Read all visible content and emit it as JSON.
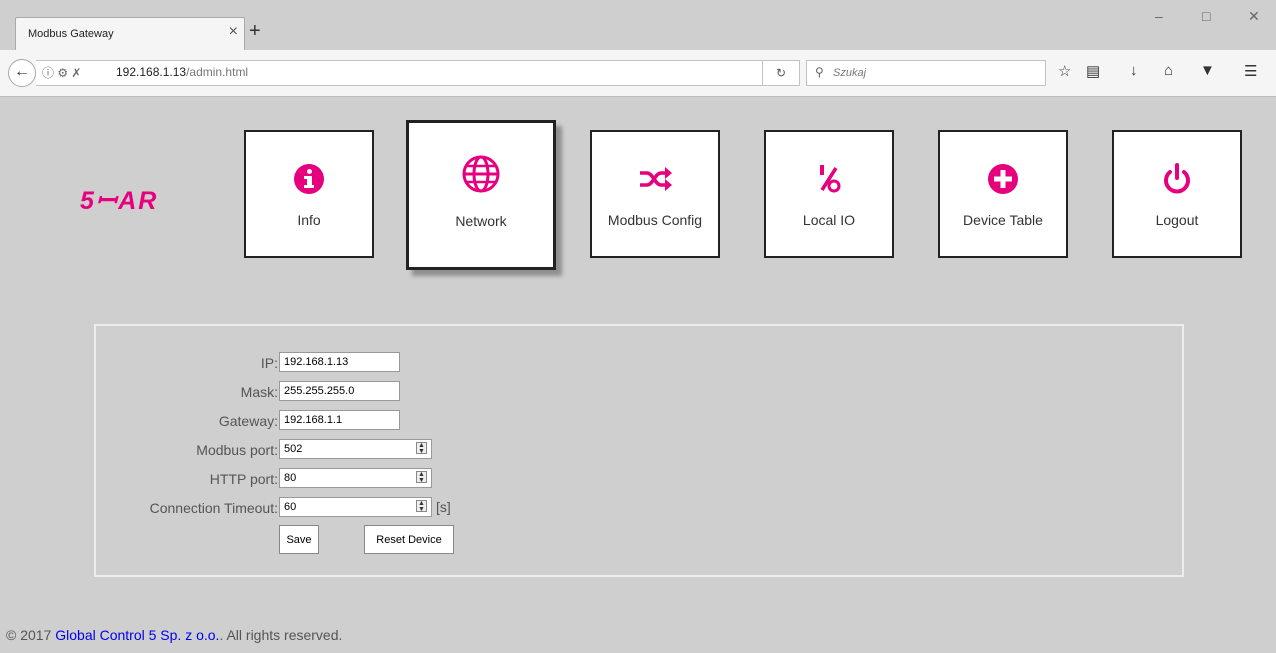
{
  "browser": {
    "tab_title": "Modbus Gateway",
    "tab_close": "×",
    "new_tab": "+",
    "window_controls": [
      "–",
      "□",
      "✕"
    ],
    "url_host": "192.168.1.13",
    "url_path": "/admin.html",
    "search_placeholder": "Szukaj",
    "toolbar_icons": [
      "star-icon",
      "clipboard-icon",
      "download-icon",
      "home-icon",
      "pocket-icon",
      "menu-icon"
    ]
  },
  "logo": "5ꟷAR",
  "nav": [
    {
      "label": "Info",
      "icon": "info-icon"
    },
    {
      "label": "Network",
      "icon": "globe-icon",
      "active": true
    },
    {
      "label": "Modbus Config",
      "icon": "shuffle-icon"
    },
    {
      "label": "Local IO",
      "icon": "percent-icon"
    },
    {
      "label": "Device Table",
      "icon": "plus-icon"
    },
    {
      "label": "Logout",
      "icon": "power-icon"
    }
  ],
  "accent_color": "#e6007e",
  "form": {
    "ip": {
      "label": "IP:",
      "value": "192.168.1.13"
    },
    "mask": {
      "label": "Mask:",
      "value": "255.255.255.0"
    },
    "gateway": {
      "label": "Gateway:",
      "value": "192.168.1.1"
    },
    "modbus_port": {
      "label": "Modbus port:",
      "value": "502"
    },
    "http_port": {
      "label": "HTTP port:",
      "value": "80"
    },
    "timeout": {
      "label": "Connection Timeout:",
      "value": "60",
      "unit": "[s]"
    },
    "save_label": "Save",
    "reset_label": "Reset Device"
  },
  "footer": {
    "prefix": "© 2017 ",
    "company": "Global Control 5 Sp. z o.o.",
    "suffix": ". All rights reserved."
  }
}
